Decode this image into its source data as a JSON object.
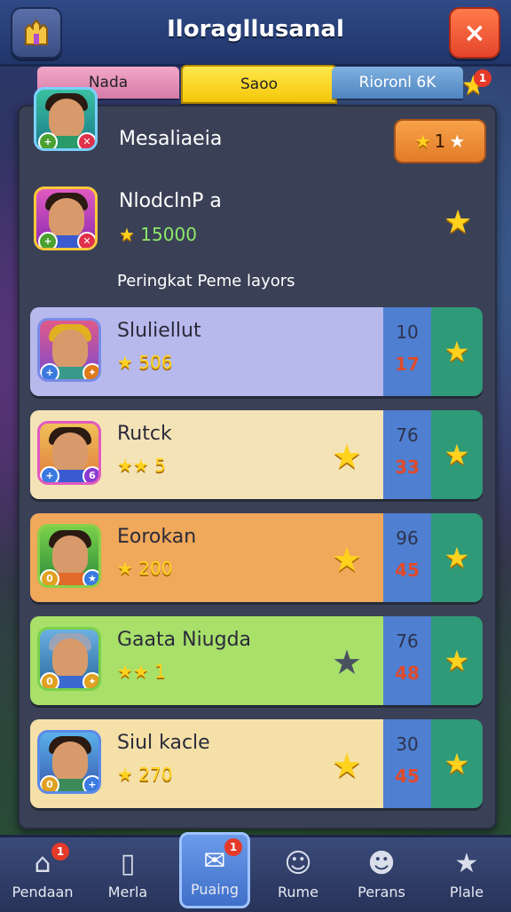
{
  "header": {
    "title": "Iloragllusanal",
    "close_icon": "×"
  },
  "tabs": [
    {
      "label": "Nada",
      "color": "#d77aa8"
    },
    {
      "label": "Saoo",
      "color": "#f5c80a",
      "active": true
    },
    {
      "label": "Rioronl 6K",
      "color": "#4f86c0"
    }
  ],
  "tab_star_badge": "1",
  "me": {
    "name": "Mesaliaeia",
    "rank_chip": "1"
  },
  "top_player": {
    "name": "NlodclnP a",
    "score": "15000"
  },
  "section_label": "Peringkat Peme layors",
  "rows": [
    {
      "name": "Sluliellut",
      "stars": "★ 506",
      "big_star": "",
      "score_top": "10",
      "score_bottom": "17",
      "color": "#b7b9ec"
    },
    {
      "name": "Rutck",
      "stars": "★★ 5",
      "big_star": "★",
      "score_top": "76",
      "score_bottom": "33",
      "color": "#f5e3b8"
    },
    {
      "name": "Eorokan",
      "stars": "★ 200",
      "big_star": "★",
      "score_top": "96",
      "score_bottom": "45",
      "color": "#f0a85a"
    },
    {
      "name": "Gaata Niugda",
      "stars": "★★ 1",
      "big_star": "★",
      "score_top": "76",
      "score_bottom": "48",
      "color": "#a8e06a"
    },
    {
      "name": "Siul kacle",
      "stars": "★ 270",
      "big_star": "★",
      "score_top": "30",
      "score_bottom": "45",
      "color": "#f5e0a8"
    }
  ],
  "nav": [
    {
      "label": "Pendaan",
      "icon": "house-icon",
      "badge": "1"
    },
    {
      "label": "Merla",
      "icon": "phone-icon"
    },
    {
      "label": "Puaing",
      "icon": "mail-icon",
      "badge": "1",
      "active": true
    },
    {
      "label": "Rume",
      "icon": "face-icon"
    },
    {
      "label": "Perans",
      "icon": "smile-icon"
    },
    {
      "label": "Plale",
      "icon": "star-icon"
    }
  ]
}
